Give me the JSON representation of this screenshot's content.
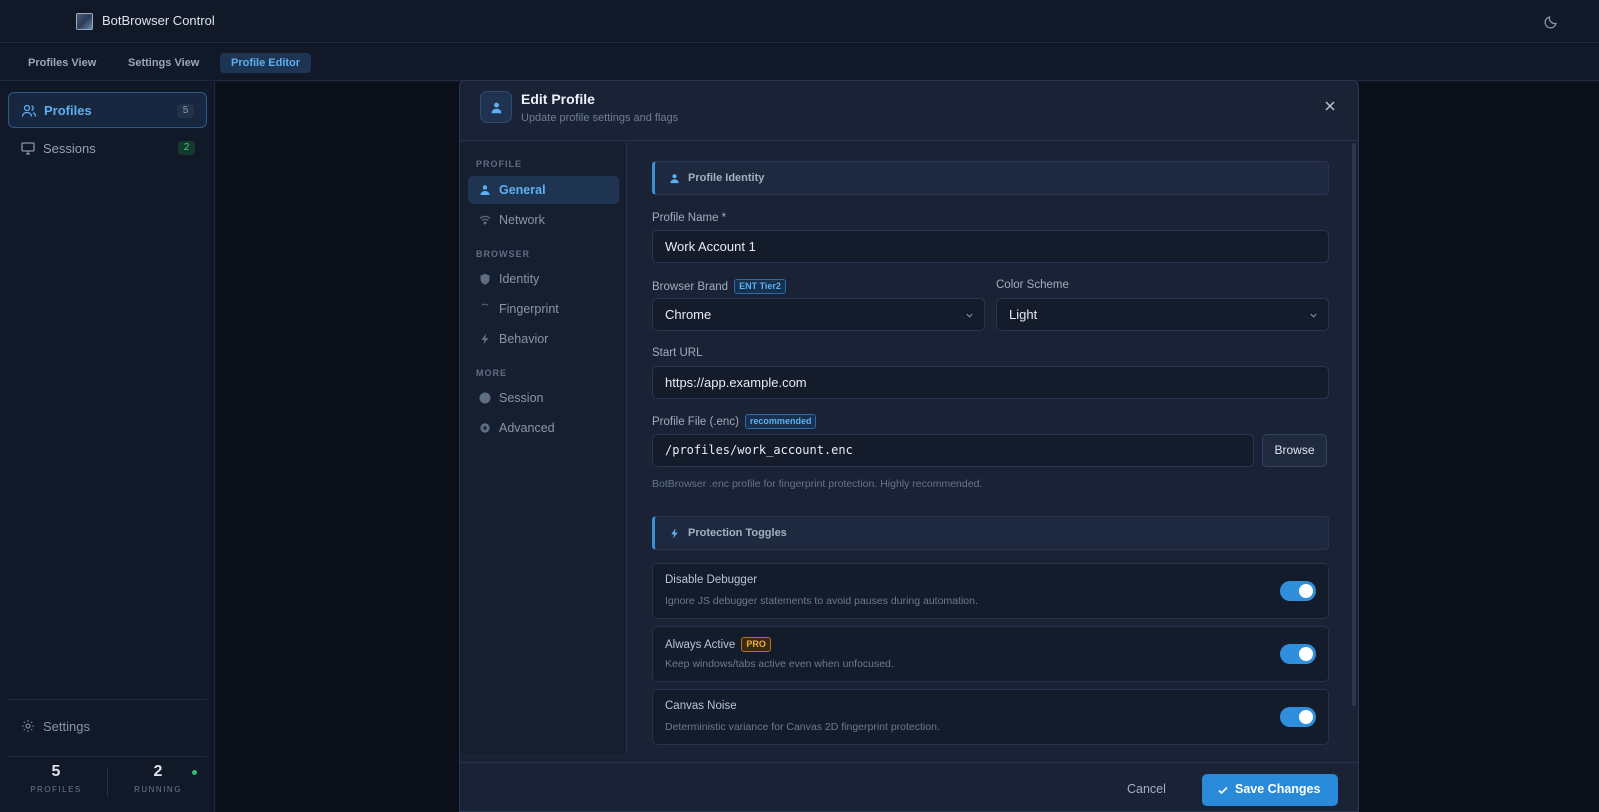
{
  "app": {
    "title": "BotBrowser Control",
    "theme_icon": "moon-icon"
  },
  "view_tabs": [
    {
      "label": "Profiles View"
    },
    {
      "label": "Settings View"
    },
    {
      "label": "Profile Editor",
      "active": true
    }
  ],
  "sidebar": {
    "items": [
      {
        "label": "Profiles",
        "count": "5",
        "icon": "users-icon",
        "active": true
      },
      {
        "label": "Sessions",
        "count": "2",
        "icon": "monitor-icon"
      }
    ],
    "settings_label": "Settings",
    "stats": [
      {
        "value": "5",
        "caption": "PROFILES"
      },
      {
        "value": "2",
        "caption": "RUNNING"
      }
    ]
  },
  "modal": {
    "title": "Edit Profile",
    "subtitle": "Update profile settings and flags",
    "nav": {
      "sections": [
        "PROFILE",
        "BROWSER",
        "MORE"
      ],
      "items": [
        {
          "label": "General",
          "icon": "user-icon",
          "active": true
        },
        {
          "label": "Network",
          "icon": "wifi-icon"
        },
        {
          "label": "Identity",
          "icon": "shield-icon"
        },
        {
          "label": "Fingerprint",
          "icon": "fingerprint-icon"
        },
        {
          "label": "Behavior",
          "icon": "bolt-icon"
        },
        {
          "label": "Session",
          "icon": "circle-icon"
        },
        {
          "label": "Advanced",
          "icon": "gear-icon"
        }
      ]
    },
    "identity": {
      "section_title": "Profile Identity",
      "profile_name_label": "Profile Name *",
      "profile_name_value": "Work Account 1",
      "browser_brand_label": "Browser Brand",
      "browser_brand_tag": "ENT Tier2",
      "browser_brand_value": "Chrome",
      "color_scheme_label": "Color Scheme",
      "color_scheme_value": "Light",
      "start_url_label": "Start URL",
      "start_url_value": "https://app.example.com",
      "profile_file_label": "Profile File (.enc)",
      "profile_file_tag": "recommended",
      "profile_file_value": "/profiles/work_account.enc",
      "browse_label": "Browse",
      "profile_file_hint": "BotBrowser .enc profile for fingerprint protection. Highly recommended."
    },
    "protection": {
      "section_title": "Protection Toggles",
      "toggles": [
        {
          "title": "Disable Debugger",
          "desc": "Ignore JS debugger statements to avoid pauses during automation.",
          "on": true
        },
        {
          "title": "Always Active",
          "tag": "PRO",
          "desc": "Keep windows/tabs active even when unfocused.",
          "on": true
        },
        {
          "title": "Canvas Noise",
          "desc": "Deterministic variance for Canvas 2D fingerprint protection.",
          "on": true
        }
      ]
    },
    "footer": {
      "cancel_label": "Cancel",
      "save_label": "Save Changes"
    }
  },
  "colors": {
    "accent": "#2a8ada",
    "success": "#34d27b",
    "pro": "#f0aa3a"
  }
}
